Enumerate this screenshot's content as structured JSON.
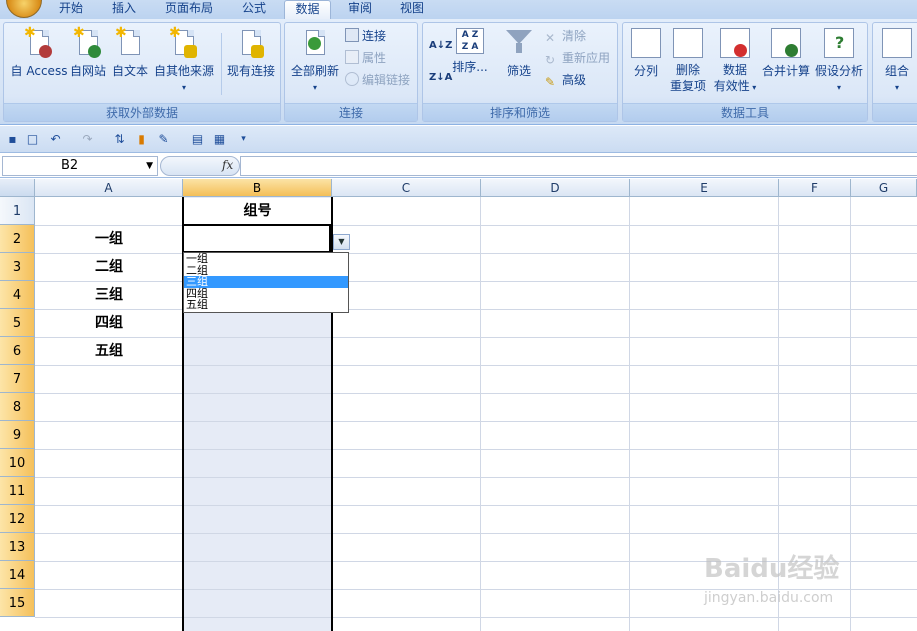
{
  "tabs": [
    "开始",
    "插入",
    "页面布局",
    "公式",
    "数据",
    "审阅",
    "视图"
  ],
  "active_tab": "数据",
  "ribbon": {
    "external": {
      "label": "获取外部数据",
      "access": "自 Access",
      "web": "自网站",
      "text": "自文本",
      "other": "自其他来源",
      "existing": "现有连接"
    },
    "connections": {
      "label": "连接",
      "refresh_all": "全部刷新",
      "connect": "连接",
      "properties": "属性",
      "edit_links": "编辑链接"
    },
    "sort": {
      "label": "排序和筛选",
      "sort": "排序...",
      "filter": "筛选",
      "clear": "清除",
      "reapply": "重新应用",
      "advanced": "高级"
    },
    "tools": {
      "label": "数据工具",
      "split": "分列",
      "remove_dup_1": "删除",
      "remove_dup_2": "重复项",
      "validation_1": "数据",
      "validation_2": "有效性",
      "consolidate": "合并计算",
      "whatif": "假设分析"
    },
    "outline": {
      "group": "组合"
    }
  },
  "formula_bar": {
    "name_box": "B2",
    "fx": "fx",
    "value": ""
  },
  "columns": [
    "A",
    "B",
    "C",
    "D",
    "E",
    "F",
    "G"
  ],
  "rows": [
    "1",
    "2",
    "3",
    "4",
    "5",
    "6",
    "7",
    "8",
    "9",
    "10",
    "11",
    "12",
    "13",
    "14",
    "15"
  ],
  "cells": {
    "B1": "组号",
    "A2": "一组",
    "A3": "二组",
    "A4": "三组",
    "A5": "四组",
    "A6": "五组"
  },
  "dropdown": {
    "options": [
      "一组",
      "二组",
      "三组",
      "四组",
      "五组"
    ],
    "highlighted": "三组"
  },
  "watermark": {
    "line1": "Baidu经验",
    "line2": "jingyan.baidu.com"
  }
}
